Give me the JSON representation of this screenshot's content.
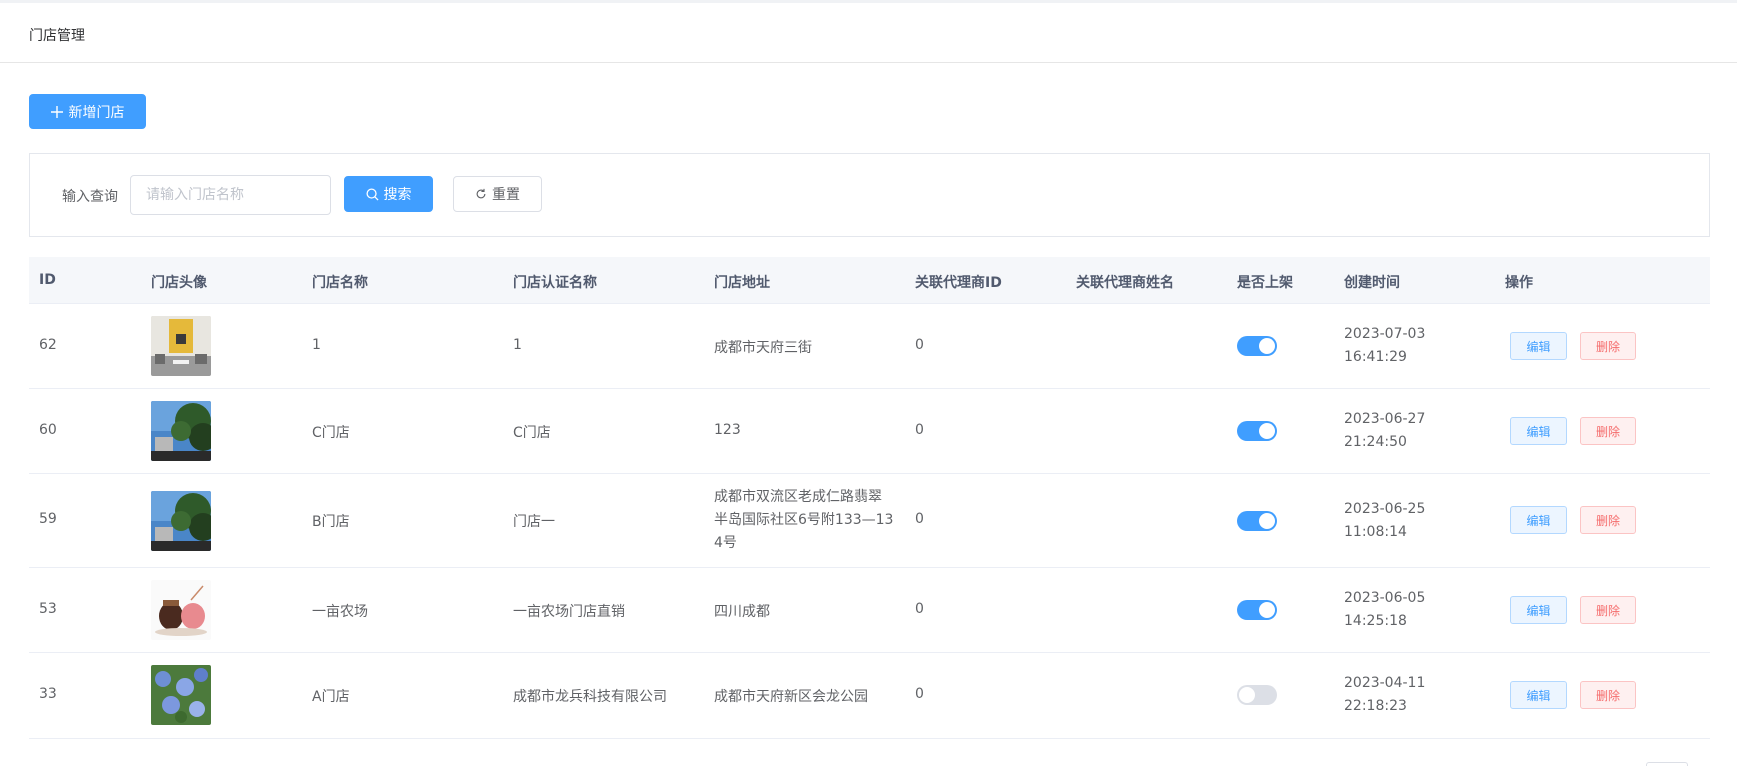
{
  "header": {
    "title": "门店管理"
  },
  "toolbar": {
    "add_label": "新增门店"
  },
  "search": {
    "label": "输入查询",
    "placeholder": "请输入门店名称",
    "search_label": "搜索",
    "reset_label": "重置"
  },
  "table": {
    "columns": [
      "ID",
      "门店头像",
      "门店名称",
      "门店认证名称",
      "门店地址",
      "关联代理商ID",
      "关联代理商姓名",
      "是否上架",
      "创建时间",
      "操作"
    ],
    "edit_label": "编辑",
    "delete_label": "删除",
    "rows": [
      {
        "id": "62",
        "name": "1",
        "cert_name": "1",
        "address": "成都市天府三街",
        "agent_id": "0",
        "agent_name": "",
        "on_shelf": true,
        "date": "2023-07-03",
        "time": "16:41:29",
        "avatar": "room"
      },
      {
        "id": "60",
        "name": "C门店",
        "cert_name": "C门店",
        "address": "123",
        "agent_id": "0",
        "agent_name": "",
        "on_shelf": true,
        "date": "2023-06-27",
        "time": "21:24:50",
        "avatar": "tree"
      },
      {
        "id": "59",
        "name": "B门店",
        "cert_name": "门店一",
        "address_lines": [
          "成都市双流区老成仁路翡翠",
          "半岛国际社区6号附133—13",
          "4号"
        ],
        "agent_id": "0",
        "agent_name": "",
        "on_shelf": true,
        "date": "2023-06-25",
        "time": "11:08:14",
        "avatar": "tree"
      },
      {
        "id": "53",
        "name": "一亩农场",
        "cert_name": "一亩农场门店直销",
        "address": "四川成都",
        "agent_id": "0",
        "agent_name": "",
        "on_shelf": true,
        "date": "2023-06-05",
        "time": "14:25:18",
        "avatar": "pots"
      },
      {
        "id": "33",
        "name": "A门店",
        "cert_name": "成都市龙兵科技有限公司",
        "address": "成都市天府新区会龙公园",
        "agent_id": "0",
        "agent_name": "",
        "on_shelf": false,
        "date": "2023-04-11",
        "time": "22:18:23",
        "avatar": "flowers"
      }
    ]
  },
  "colors": {
    "primary": "#409eff",
    "danger": "#f56c6c",
    "switch_off": "#dcdfe6"
  }
}
